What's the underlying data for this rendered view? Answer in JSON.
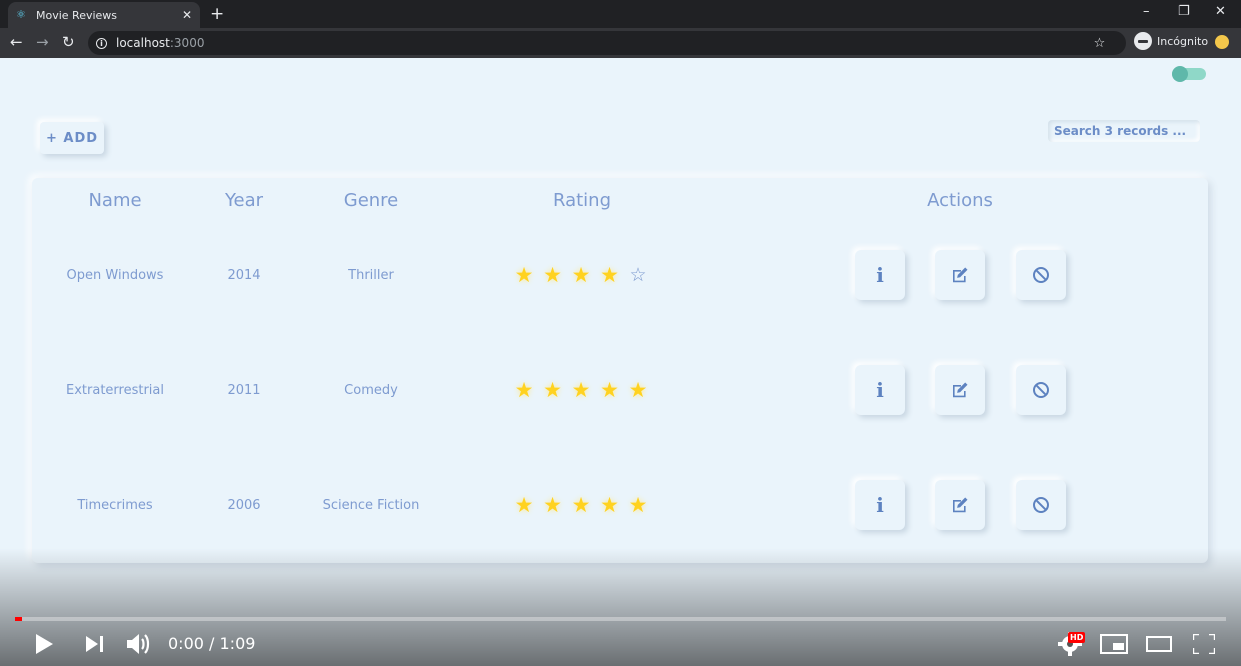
{
  "browser": {
    "tab_title": "Movie Reviews",
    "tab_close": "✕",
    "new_tab": "+",
    "window_controls": [
      "–",
      "❐",
      "✕"
    ],
    "nav": {
      "back": "←",
      "forward": "→",
      "reload": "↻"
    },
    "url_host": "localhost",
    "url_port": ":3000",
    "bookmark_star": "☆",
    "incognito_label": "Incógnito"
  },
  "app": {
    "add_button": "+ ADD",
    "search_placeholder": "Search 3 records ...",
    "columns": [
      "Name",
      "Year",
      "Genre",
      "Rating",
      "Actions"
    ],
    "rows": [
      {
        "name": "Open Windows",
        "year": "2014",
        "genre": "Thriller",
        "rating": 4,
        "max_rating": 5
      },
      {
        "name": "Extraterrestrial",
        "year": "2011",
        "genre": "Comedy",
        "rating": 5,
        "max_rating": 5
      },
      {
        "name": "Timecrimes",
        "year": "2006",
        "genre": "Science Fiction",
        "rating": 5,
        "max_rating": 5
      }
    ],
    "action_icons": [
      "info-icon",
      "edit-icon",
      "ban-icon"
    ],
    "toggle_on": true
  },
  "video": {
    "time_current": "0:00",
    "time_total": "1:09",
    "time_display": "0:00 / 1:09",
    "progress": 0.0,
    "hd_badge": "HD"
  },
  "colors": {
    "background": "#eaf4fb",
    "text": "#7e9bd0",
    "star_on": "#ffd21f",
    "accent": "#6c8dc7",
    "progress": "#ff0000"
  }
}
